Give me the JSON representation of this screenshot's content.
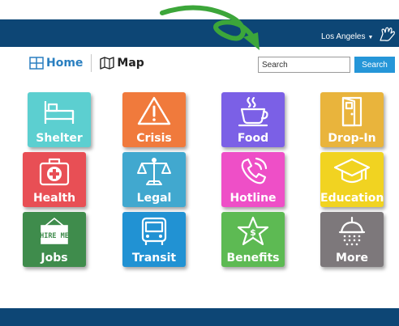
{
  "header": {
    "city_label": "Los Angeles",
    "colors": {
      "bar": "#0d4675",
      "accent": "#2596d8",
      "arrow": "#3ca63a"
    },
    "icons": {
      "hand": "hand-wave-icon",
      "caret": "caret-down-icon"
    }
  },
  "nav": {
    "home_label": "Home",
    "map_label": "Map",
    "home_icon": "grid-icon",
    "map_icon": "map-icon"
  },
  "search": {
    "placeholder": "Search",
    "button_label": "Search"
  },
  "tiles": [
    {
      "label": "Shelter",
      "icon": "bed-icon",
      "color": "#5ccfd0"
    },
    {
      "label": "Crisis",
      "icon": "warning-icon",
      "color": "#f07a3c"
    },
    {
      "label": "Food",
      "icon": "coffee-cup-icon",
      "color": "#7b60e6"
    },
    {
      "label": "Drop-In",
      "icon": "door-icon",
      "color": "#e9b43c"
    },
    {
      "label": "Health",
      "icon": "medical-kit-icon",
      "color": "#e84f55"
    },
    {
      "label": "Legal",
      "icon": "scales-icon",
      "color": "#41a8cf"
    },
    {
      "label": "Hotline",
      "icon": "phone-icon",
      "color": "#ee4fc7"
    },
    {
      "label": "Education",
      "icon": "graduation-cap-icon",
      "color": "#f1d321"
    },
    {
      "label": "Jobs",
      "icon": "hire-me-sign-icon",
      "color": "#3f8c4c"
    },
    {
      "label": "Transit",
      "icon": "bus-icon",
      "color": "#2192d3"
    },
    {
      "label": "Benefits",
      "icon": "star-dollar-icon",
      "color": "#5dba53"
    },
    {
      "label": "More",
      "icon": "shower-icon",
      "color": "#7d787b"
    }
  ],
  "jobs_sign_text": "HIRE ME"
}
